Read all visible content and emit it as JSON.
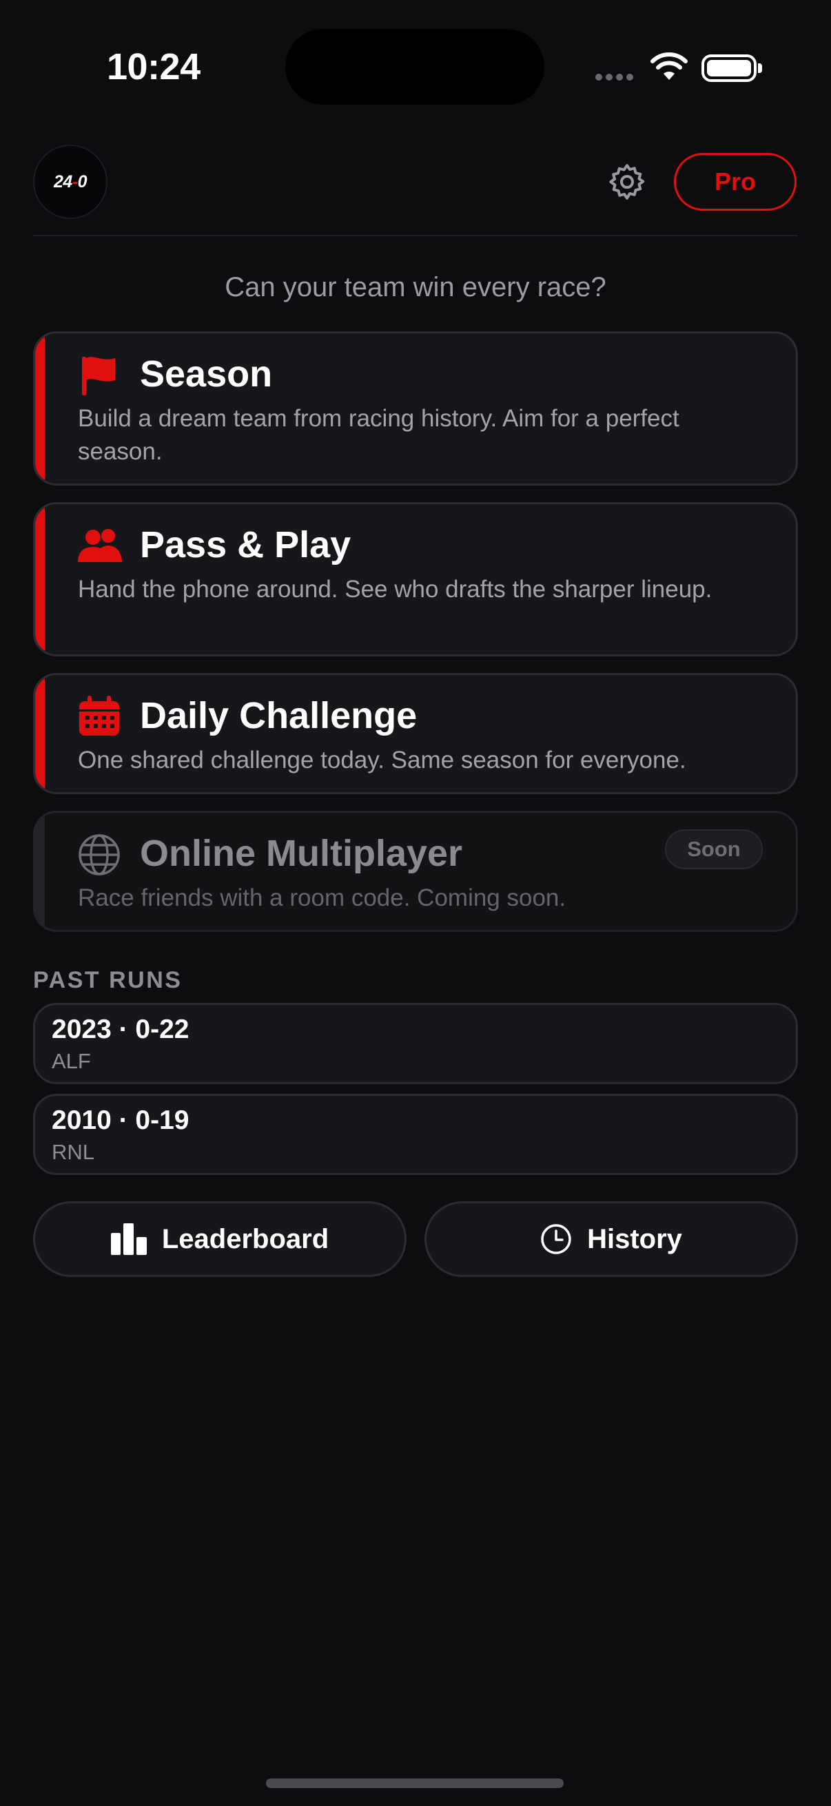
{
  "status_bar": {
    "time": "10:24"
  },
  "header": {
    "logo_text_left": "24",
    "logo_text_dash": "-",
    "logo_text_right": "0",
    "pro_label": "Pro",
    "settings_icon": "gear-icon"
  },
  "tagline": "Can your team win every race?",
  "modes": [
    {
      "title": "Season",
      "description": "Build a dream team from racing history. Aim for a perfect season.",
      "icon": "flag-icon",
      "enabled": true
    },
    {
      "title": "Pass & Play",
      "description": "Hand the phone around. See who drafts the sharper lineup.",
      "icon": "people-icon",
      "enabled": true
    },
    {
      "title": "Daily Challenge",
      "description": "One shared challenge today. Same season for everyone.",
      "icon": "calendar-icon",
      "enabled": true
    },
    {
      "title": "Online Multiplayer",
      "description": "Race friends with a room code. Coming soon.",
      "icon": "globe-icon",
      "enabled": false,
      "badge": "Soon"
    }
  ],
  "past_runs": {
    "label": "PAST RUNS",
    "items": [
      {
        "title": "2023 · 0-22",
        "subtitle": "ALF"
      },
      {
        "title": "2010 · 0-19",
        "subtitle": "RNL"
      }
    ]
  },
  "bottom_buttons": {
    "leaderboard": {
      "label": "Leaderboard",
      "icon": "bar-chart-icon"
    },
    "history": {
      "label": "History",
      "icon": "clock-icon"
    }
  },
  "colors": {
    "accent": "#e01010",
    "background": "#0d0d10",
    "card": "#17171b"
  }
}
